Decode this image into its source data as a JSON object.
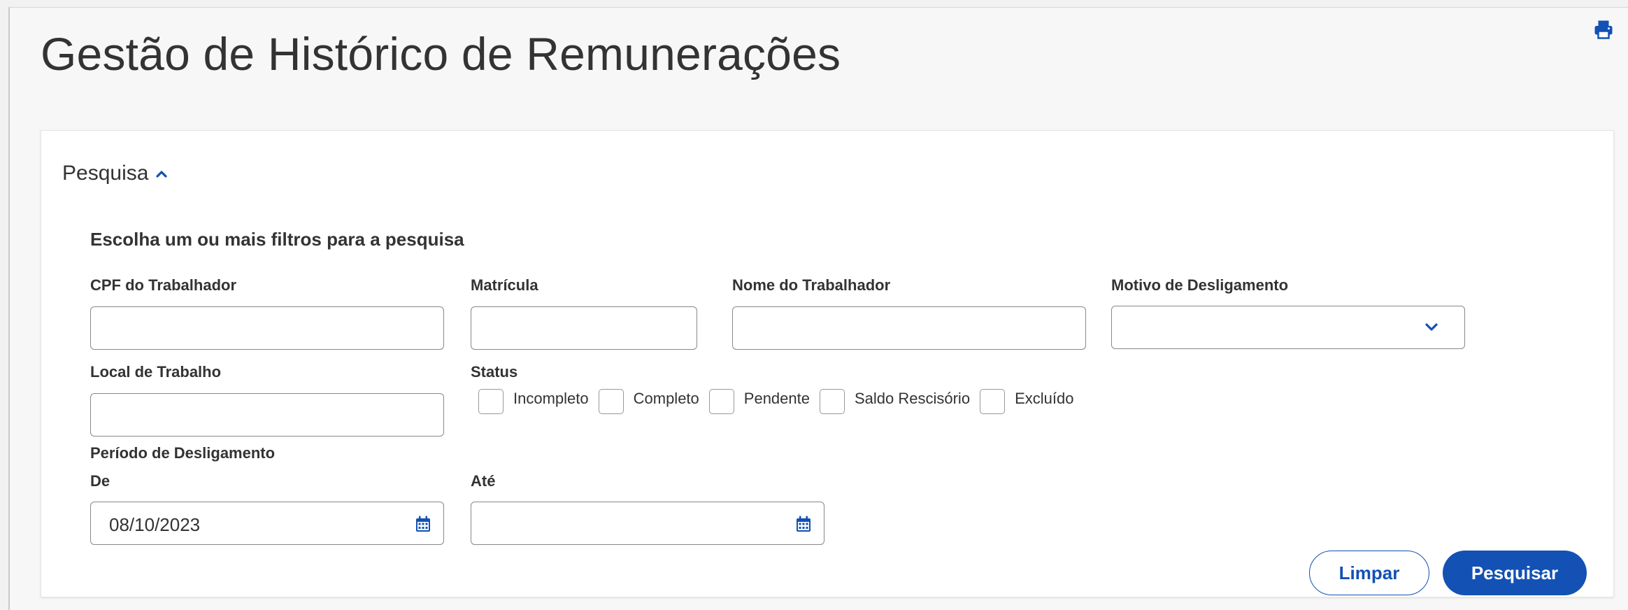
{
  "page": {
    "title": "Gestão de Histórico de Remunerações"
  },
  "icons": {
    "print": "print-icon",
    "section_chevron": "chevron-up-icon",
    "select_chevron": "chevron-down-icon",
    "calendar": "calendar-icon"
  },
  "colors": {
    "primary": "#1351b4",
    "text": "#333333",
    "border": "#888888"
  },
  "search": {
    "section_label": "Pesquisa",
    "instructions": "Escolha um ou mais filtros para a pesquisa",
    "cpf": {
      "label": "CPF do Trabalhador",
      "value": ""
    },
    "matricula": {
      "label": "Matrícula",
      "value": ""
    },
    "nome": {
      "label": "Nome do Trabalhador",
      "value": ""
    },
    "motivo": {
      "label": "Motivo de Desligamento",
      "selected": ""
    },
    "local": {
      "label": "Local de Trabalho",
      "value": ""
    },
    "status": {
      "label": "Status",
      "options": [
        {
          "label": "Incompleto",
          "checked": false
        },
        {
          "label": "Completo",
          "checked": false
        },
        {
          "label": "Pendente",
          "checked": false
        },
        {
          "label": "Saldo Rescisório",
          "checked": false
        },
        {
          "label": "Excluído",
          "checked": false
        }
      ]
    },
    "periodo": {
      "label": "Período de Desligamento",
      "de": {
        "label": "De",
        "value": "08/10/2023"
      },
      "ate": {
        "label": "Até",
        "value": ""
      }
    },
    "buttons": {
      "clear": "Limpar",
      "search": "Pesquisar"
    }
  }
}
